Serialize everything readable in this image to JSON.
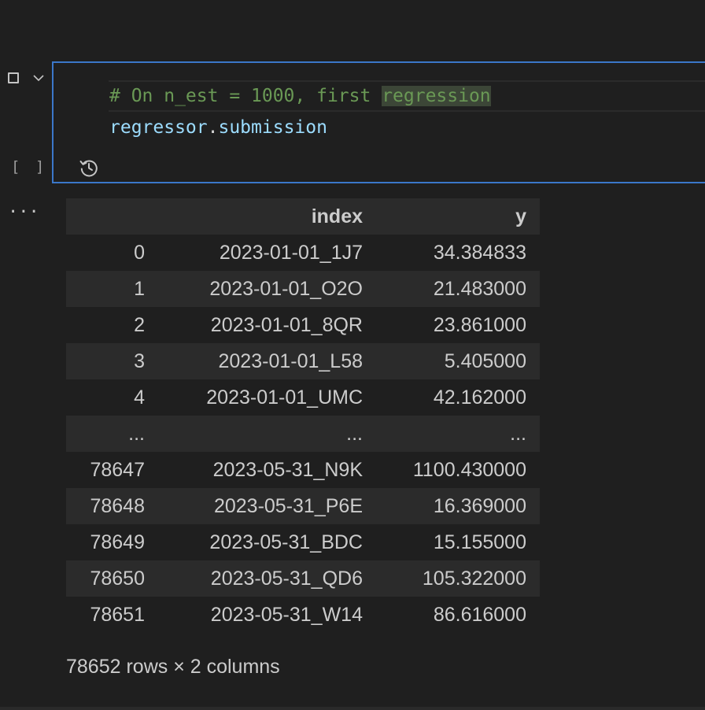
{
  "cell": {
    "execution_count": "[ ]",
    "output_more": "...",
    "code": {
      "line1_prefix": "# On n_est = 1000, first ",
      "line1_selected": "regression",
      "line2_object": "regressor",
      "line2_dot": ".",
      "line2_attr": "submission"
    }
  },
  "output": {
    "columns": [
      "",
      "index",
      "y"
    ],
    "rows": [
      [
        "0",
        "2023-01-01_1J7",
        "34.384833"
      ],
      [
        "1",
        "2023-01-01_O2O",
        "21.483000"
      ],
      [
        "2",
        "2023-01-01_8QR",
        "23.861000"
      ],
      [
        "3",
        "2023-01-01_L58",
        "5.405000"
      ],
      [
        "4",
        "2023-01-01_UMC",
        "42.162000"
      ],
      [
        "...",
        "...",
        "..."
      ],
      [
        "78647",
        "2023-05-31_N9K",
        "1100.430000"
      ],
      [
        "78648",
        "2023-05-31_P6E",
        "16.369000"
      ],
      [
        "78649",
        "2023-05-31_BDC",
        "15.155000"
      ],
      [
        "78650",
        "2023-05-31_QD6",
        "105.322000"
      ],
      [
        "78651",
        "2023-05-31_W14",
        "86.616000"
      ]
    ],
    "shape": "78652 rows × 2 columns"
  },
  "icons": {
    "checkbox": "checkbox-icon",
    "collapse": "chevron-down-icon",
    "history": "history-icon"
  },
  "colors": {
    "cell_border": "#3b77c9",
    "comment": "#6a9955",
    "variable": "#9cdcfe",
    "background": "#1f1f1f"
  }
}
